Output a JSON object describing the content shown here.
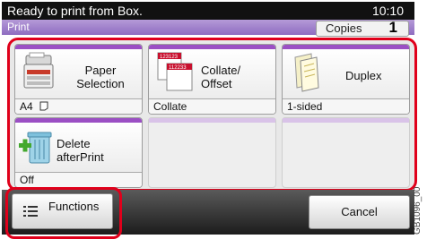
{
  "status": {
    "message": "Ready to print from Box.",
    "time": "10:10"
  },
  "title": {
    "text": "Print",
    "copies_label": "Copies",
    "copies_value": "1"
  },
  "tiles": [
    {
      "label_lines": [
        "Paper",
        "Selection"
      ],
      "value": "A4",
      "icon": "printer-icon"
    },
    {
      "label_lines": [
        "Collate/",
        "Offset"
      ],
      "value": "Collate",
      "icon": "collate-sheets-icon"
    },
    {
      "label_lines": [
        "Duplex"
      ],
      "value": "1-sided",
      "icon": "duplex-pages-icon"
    },
    {
      "label_lines": [
        "Delete",
        "afterPrint"
      ],
      "value": "Off",
      "icon": "trash-icon"
    }
  ],
  "bottom": {
    "functions_label": "Functions",
    "cancel_label": "Cancel"
  },
  "side_id": "GB1096_00",
  "colors": {
    "accent_purple": "#9b4fc4",
    "highlight_red": "#e0001b"
  }
}
